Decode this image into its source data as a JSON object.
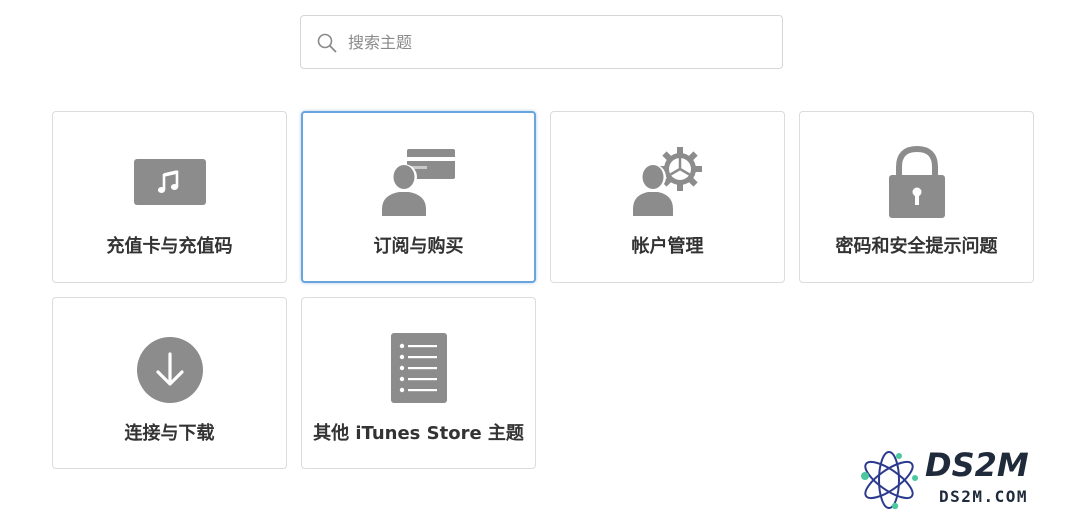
{
  "search": {
    "placeholder": "搜索主题",
    "value": ""
  },
  "tiles": [
    {
      "label": "充值卡与充值码",
      "icon": "music-card-icon"
    },
    {
      "label": "订阅与购买",
      "icon": "person-card-icon"
    },
    {
      "label": "帐户管理",
      "icon": "person-gear-icon"
    },
    {
      "label": "密码和安全提示问题",
      "icon": "lock-icon"
    },
    {
      "label": "连接与下载",
      "icon": "download-icon"
    },
    {
      "label": "其他 iTunes Store 主题",
      "icon": "list-icon"
    }
  ],
  "watermark": {
    "title": "DS2M",
    "subtitle": "DS2M.COM"
  },
  "colors": {
    "icon_gray": "#8c8c8c",
    "active_border": "#6aa4dc",
    "text": "#333333"
  }
}
